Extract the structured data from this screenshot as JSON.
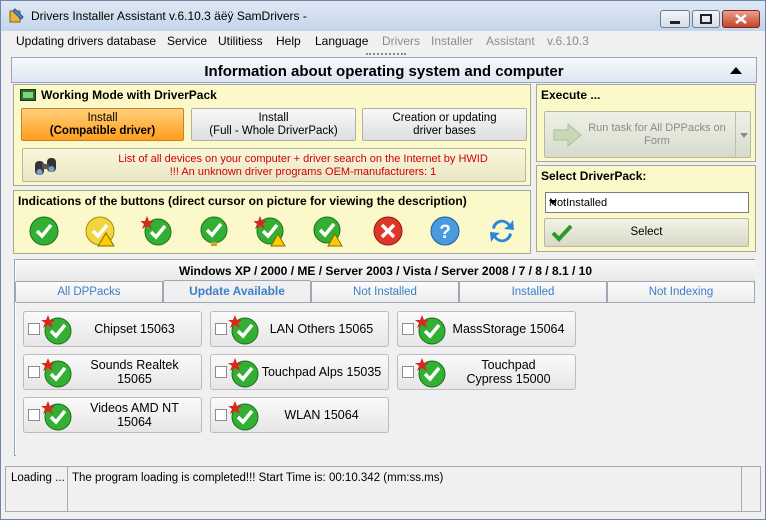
{
  "window": {
    "title": "Drivers Installer Assistant v.6.10.3 äëÿ SamDrivers -"
  },
  "menu": {
    "items": [
      "Updating drivers database",
      "Service",
      "Utilitiess",
      "Help",
      "Language"
    ],
    "disabled_items": [
      "Drivers",
      "Installer",
      "Assistant",
      "v.6.10.3"
    ]
  },
  "info_bar": {
    "title": "Information about operating system and computer"
  },
  "working_mode": {
    "title": "Working Mode with DriverPack",
    "install_compatible": [
      "Install",
      "(Compatible driver)"
    ],
    "install_full": [
      "Install",
      "(Full - Whole DriverPack)"
    ],
    "creation": [
      "Creation or updating",
      "driver bases"
    ],
    "hwid_text": [
      "List of all devices on your computer + driver search on the Internet by HWID",
      "!!! An unknown driver programs OEM-manufacturers: 1"
    ]
  },
  "execute": {
    "title": "Execute ...",
    "run_button": [
      "Run task for All DPPacks on",
      "Form"
    ]
  },
  "select_driverpack": {
    "title": "Select DriverPack:",
    "selected": "NotInstalled",
    "select_button": "Select"
  },
  "indications": {
    "title": "Indications of the buttons (direct cursor on picture for viewing the description)",
    "icons": [
      "check-icon",
      "check-yellow-warning-icon",
      "check-star-icon",
      "check-bulb-icon",
      "check-star-warning-icon",
      "check-bulb-warning-icon",
      "error-x-icon",
      "help-question-icon",
      "refresh-arrows-icon"
    ]
  },
  "os_tab": "Windows XP / 2000 / ME / Server 2003 / Vista / Server 2008 / 7 / 8 / 8.1 / 10",
  "tabs": [
    "All DPPacks",
    "Update Available",
    "Not Installed",
    "Installed",
    "Not Indexing"
  ],
  "active_tab": "Update Available",
  "drivers": [
    {
      "label": "Chipset 15063"
    },
    {
      "label": "LAN Others 15065"
    },
    {
      "label": "MassStorage 15064"
    },
    {
      "label": "Sounds Realtek 15065"
    },
    {
      "label": "Touchpad Alps 15035"
    },
    {
      "label": "Touchpad Cypress 15000"
    },
    {
      "label": "Videos AMD NT 15064"
    },
    {
      "label": "WLAN 15064"
    }
  ],
  "status": {
    "left": "Loading ...",
    "message": "The program loading is completed!!! Start Time is: 00:10.342 (mm:ss.ms)"
  },
  "colors": {
    "accent_orange": "#ff9d1d",
    "panel_yellow": "#fbf9c9",
    "check_green": "#1fa21f",
    "tab_blue": "#3b7ec9",
    "hwid_red": "#d40000"
  }
}
